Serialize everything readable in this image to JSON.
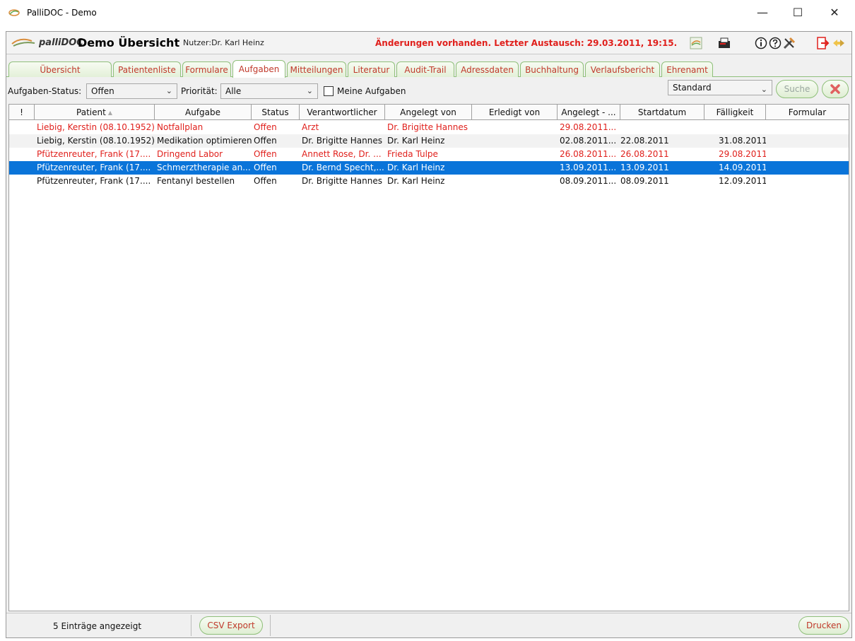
{
  "window": {
    "title": "PalliDOC - Demo",
    "controls": {
      "minimize": "—",
      "maximize": "☐",
      "close": "✕"
    }
  },
  "header": {
    "logo_text": "palliDOC",
    "page_title": "Demo Übersicht",
    "user": "Nutzer:Dr. Karl Heinz",
    "changes_notice": "Änderungen vorhanden. Letzter Austausch: 29.03.2011, 19:15.",
    "icons": [
      "sync-icon",
      "fax-icon",
      "info-icon",
      "help-icon",
      "tools-icon",
      "logout-icon",
      "switch-icon"
    ]
  },
  "tabs": [
    {
      "label": "Übersicht",
      "active": false
    },
    {
      "label": "Patientenliste",
      "active": false
    },
    {
      "label": "Formulare",
      "active": false
    },
    {
      "label": "Aufgaben",
      "active": true
    },
    {
      "label": "Mitteilungen",
      "active": false
    },
    {
      "label": "Literatur",
      "active": false
    },
    {
      "label": "Audit-Trail",
      "active": false
    },
    {
      "label": "Adressdaten",
      "active": false
    },
    {
      "label": "Buchhaltung",
      "active": false
    },
    {
      "label": "Verlaufsbericht",
      "active": false
    },
    {
      "label": "Ehrenamt",
      "active": false
    }
  ],
  "filters": {
    "status_label": "Aufgaben-Status:",
    "status_value": "Offen",
    "priority_label": "Priorität:",
    "priority_value": "Alle",
    "my_tasks_label": "Meine Aufgaben",
    "my_tasks_checked": false,
    "view_value": "Standard",
    "search_label": "Suche"
  },
  "table": {
    "columns": [
      "!",
      "Patient",
      "Aufgabe",
      "Status",
      "Verantwortlicher",
      "Angelegt von",
      "Erledigt von",
      "Angelegt - ...",
      "Startdatum",
      "Fälligkeit",
      "Formular"
    ],
    "rows": [
      {
        "style": "red",
        "cells": [
          "",
          "Liebig, Kerstin (08.10.1952)",
          "Notfallplan",
          "Offen",
          "Arzt",
          "Dr. Brigitte Hannes",
          "",
          "29.08.2011...",
          "",
          "",
          ""
        ]
      },
      {
        "style": "alt",
        "cells": [
          "",
          "Liebig, Kerstin (08.10.1952)",
          "Medikation optimieren",
          "Offen",
          "Dr. Brigitte Hannes",
          "Dr. Karl Heinz",
          "",
          "02.08.2011...",
          "22.08.2011",
          "31.08.2011",
          ""
        ]
      },
      {
        "style": "red",
        "cells": [
          "",
          "Pfützenreuter, Frank (17....",
          "Dringend Labor",
          "Offen",
          "Annett Rose, Dr. ...",
          "Frieda Tulpe",
          "",
          "26.08.2011...",
          "26.08.2011",
          "29.08.2011",
          ""
        ]
      },
      {
        "style": "sel",
        "cells": [
          "",
          "Pfützenreuter, Frank (17....",
          "Schmerztherapie an...",
          "Offen",
          "Dr. Bernd Specht,...",
          "Dr. Karl Heinz",
          "",
          "13.09.2011...",
          "13.09.2011",
          "14.09.2011...",
          ""
        ]
      },
      {
        "style": "normal",
        "cells": [
          "",
          "Pfützenreuter, Frank (17....",
          "Fentanyl  bestellen",
          "Offen",
          "Dr. Brigitte Hannes",
          "Dr. Karl Heinz",
          "",
          "08.09.2011...",
          "08.09.2011",
          "12.09.2011",
          ""
        ]
      }
    ]
  },
  "footer": {
    "count_text": "5 Einträge angezeigt",
    "csv_label": "CSV Export",
    "print_label": "Drucken"
  }
}
